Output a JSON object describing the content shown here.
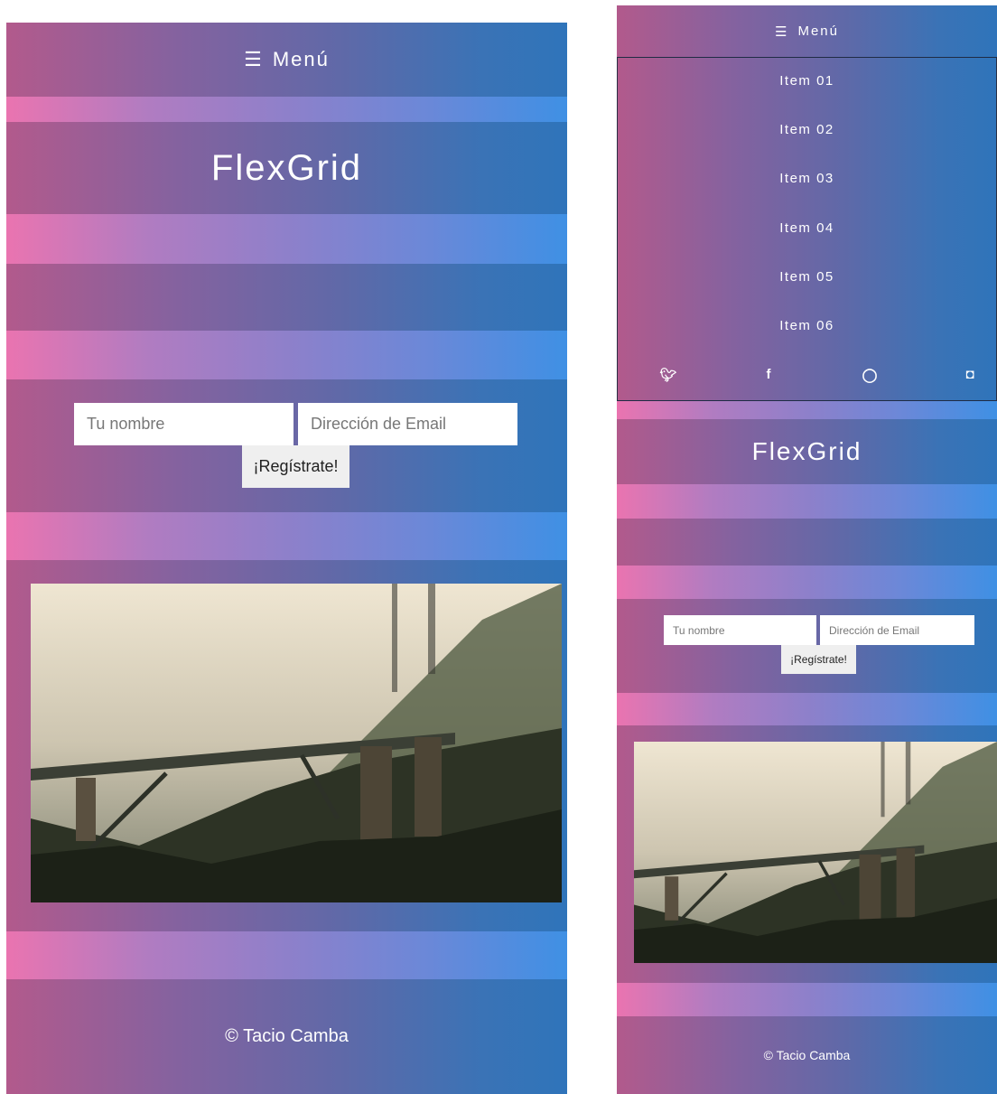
{
  "menu": {
    "icon": "hamburger-icon",
    "glyph": "☰",
    "label": "Menú"
  },
  "brand": {
    "title": "FlexGrid"
  },
  "signup": {
    "name_placeholder": "Tu nombre",
    "email_placeholder": "Dirección de Email",
    "button_label": "¡Regístrate!"
  },
  "nav": {
    "items": [
      "Item 01",
      "Item 02",
      "Item 03",
      "Item 04",
      "Item 05",
      "Item 06"
    ]
  },
  "social": [
    {
      "name": "twitter-icon",
      "glyph": "🐦︎"
    },
    {
      "name": "facebook-icon",
      "glyph": "f"
    },
    {
      "name": "github-icon",
      "glyph": "◯"
    },
    {
      "name": "instagram-icon",
      "glyph": "◘"
    }
  ],
  "footer": {
    "copyright": "© Tacio Camba"
  },
  "colors": {
    "gradient_dark_start": "#b25a8c",
    "gradient_dark_end": "#2f74ba",
    "gradient_light_start": "#ea74b0",
    "gradient_light_end": "#3f90e4"
  }
}
